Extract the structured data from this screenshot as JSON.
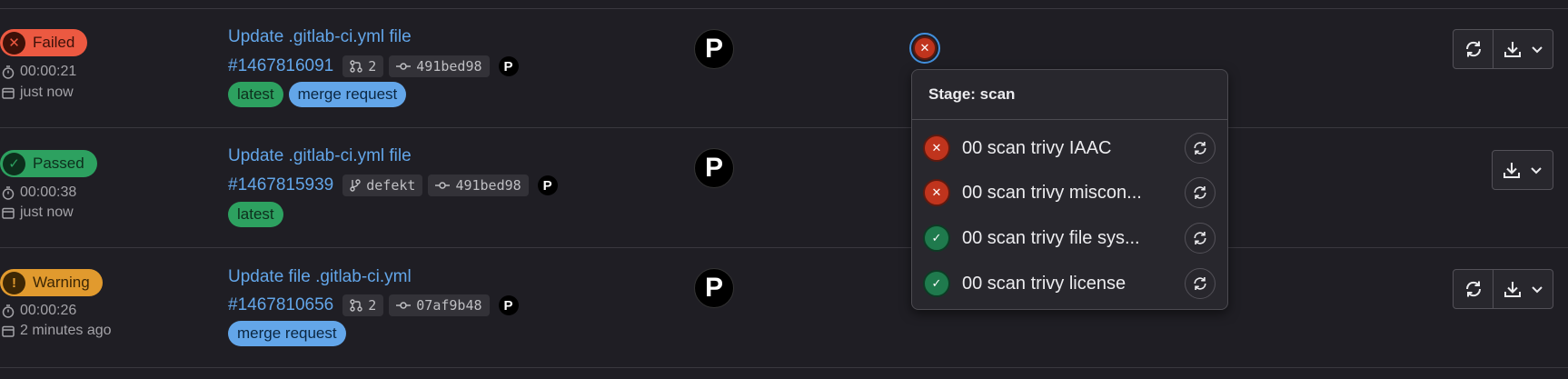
{
  "pipelines": [
    {
      "status": "Failed",
      "duration": "00:00:21",
      "time": "just now",
      "title": "Update .gitlab-ci.yml file",
      "id": "#1467816091",
      "ref": "2",
      "commit": "491bed98",
      "avatar": "P",
      "tags": [
        "latest",
        "merge request"
      ]
    },
    {
      "status": "Passed",
      "duration": "00:00:38",
      "time": "just now",
      "title": "Update .gitlab-ci.yml file",
      "id": "#1467815939",
      "ref": "defekt",
      "commit": "491bed98",
      "avatar": "P",
      "tags": [
        "latest"
      ]
    },
    {
      "status": "Warning",
      "duration": "00:00:26",
      "time": "2 minutes ago",
      "title": "Update file .gitlab-ci.yml",
      "id": "#1467810656",
      "ref": "2",
      "commit": "07af9b48",
      "avatar": "P",
      "tags": [
        "merge request"
      ]
    }
  ],
  "stage_dropdown": {
    "header": "Stage: scan",
    "jobs": [
      {
        "label": "00 scan trivy IAAC",
        "status": "failed"
      },
      {
        "label": "00 scan trivy miscon...",
        "status": "failed"
      },
      {
        "label": "00 scan trivy file sys...",
        "status": "passed"
      },
      {
        "label": "00 scan trivy license",
        "status": "passed"
      }
    ]
  },
  "icons": {
    "failed": "close-circle-icon",
    "passed": "check-circle-icon",
    "warning": "exclamation-circle-icon",
    "duration": "timer-icon",
    "time": "calendar-icon",
    "merge_request": "merge-request-icon",
    "branch": "branch-icon",
    "commit": "commit-icon",
    "retry": "retry-icon",
    "download": "download-icon",
    "dropdown": "chevron-down-icon"
  },
  "colors": {
    "failed": "#ec5941",
    "passed": "#2da160",
    "warning": "#e19a2e",
    "link": "#63a6e9"
  }
}
